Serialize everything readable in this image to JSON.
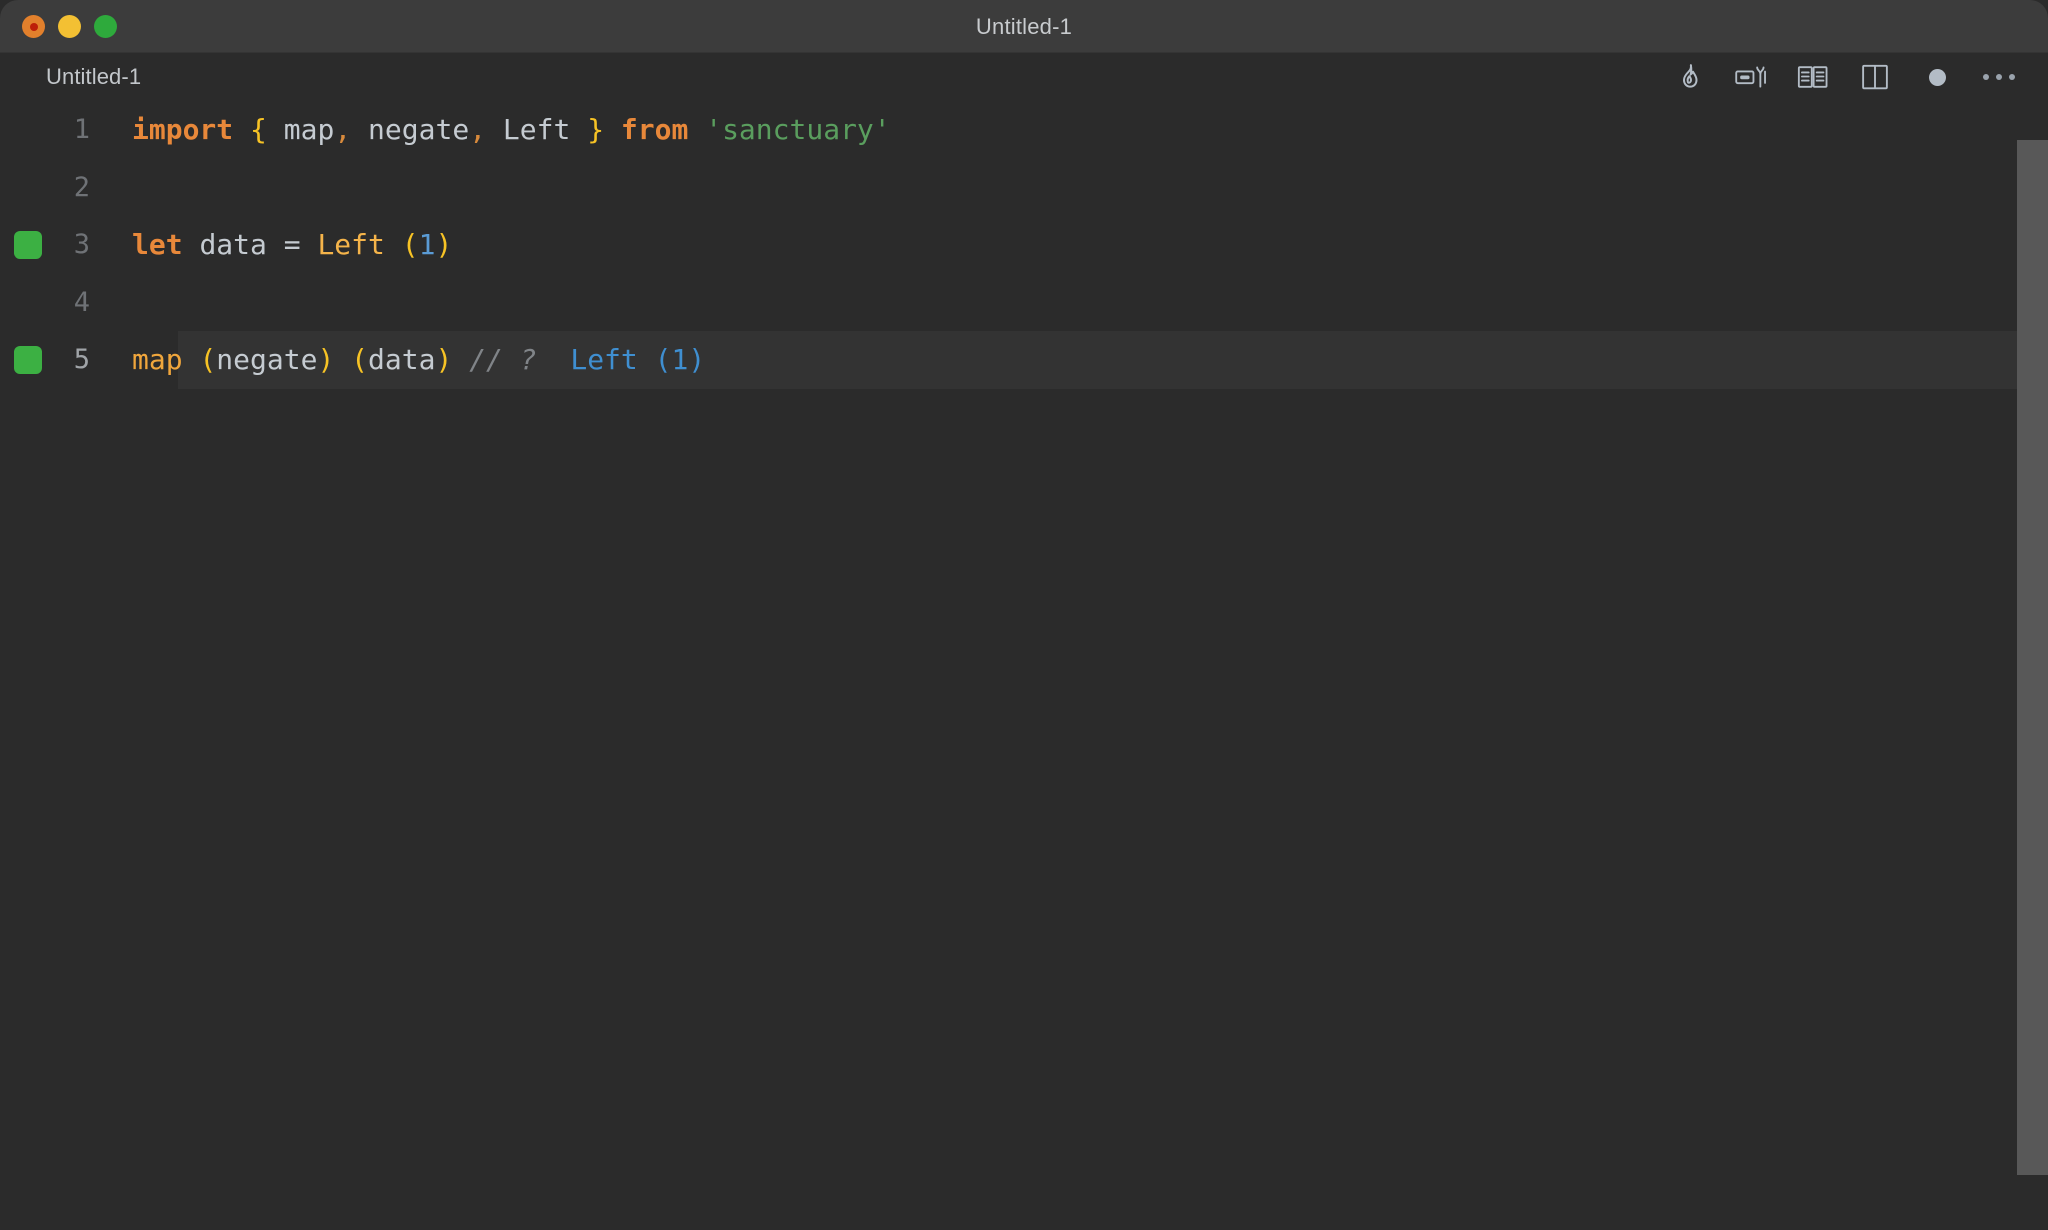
{
  "window": {
    "title": "Untitled-1",
    "traffic_lights": [
      {
        "name": "close",
        "color": "#e2802c"
      },
      {
        "name": "minimize",
        "color": "#f3c033"
      },
      {
        "name": "maximize",
        "color": "#2eaa3c"
      }
    ]
  },
  "tabs": [
    {
      "label": "Untitled-1",
      "active": true,
      "dirty": true
    }
  ],
  "editor_actions": [
    {
      "name": "quokka-flame-icon",
      "title": "Start on Current File"
    },
    {
      "name": "run-code-icon",
      "title": "Run Code"
    },
    {
      "name": "open-preview-icon",
      "title": "Open Preview to the Side"
    },
    {
      "name": "split-editor-icon",
      "title": "Split Editor Right"
    },
    {
      "name": "unsaved-dot-icon",
      "title": "Unsaved changes"
    },
    {
      "name": "more-actions-icon",
      "title": "More Actions..."
    }
  ],
  "code": {
    "language": "javascript",
    "active_line": 5,
    "lines": [
      {
        "number": "1",
        "gutter": null,
        "active": false,
        "tokens": [
          {
            "t": "import",
            "c": "kw"
          },
          {
            "t": " ",
            "c": "ident"
          },
          {
            "t": "{",
            "c": "brace"
          },
          {
            "t": " ",
            "c": "ident"
          },
          {
            "t": "map",
            "c": "ident"
          },
          {
            "t": ",",
            "c": "punct"
          },
          {
            "t": " ",
            "c": "ident"
          },
          {
            "t": "negate",
            "c": "ident"
          },
          {
            "t": ",",
            "c": "punct"
          },
          {
            "t": " ",
            "c": "ident"
          },
          {
            "t": "Left",
            "c": "ident"
          },
          {
            "t": " ",
            "c": "ident"
          },
          {
            "t": "}",
            "c": "brace"
          },
          {
            "t": " ",
            "c": "ident"
          },
          {
            "t": "from",
            "c": "kw"
          },
          {
            "t": " ",
            "c": "ident"
          },
          {
            "t": "'sanctuary'",
            "c": "str"
          }
        ]
      },
      {
        "number": "2",
        "gutter": null,
        "active": false,
        "tokens": []
      },
      {
        "number": "3",
        "gutter": "green",
        "active": false,
        "tokens": [
          {
            "t": "let",
            "c": "kw"
          },
          {
            "t": " ",
            "c": "ident"
          },
          {
            "t": "data",
            "c": "ident"
          },
          {
            "t": " ",
            "c": "ident"
          },
          {
            "t": "=",
            "c": "ident"
          },
          {
            "t": " ",
            "c": "ident"
          },
          {
            "t": "Left",
            "c": "fname"
          },
          {
            "t": " ",
            "c": "ident"
          },
          {
            "t": "(",
            "c": "paren"
          },
          {
            "t": "1",
            "c": "num"
          },
          {
            "t": ")",
            "c": "paren"
          }
        ]
      },
      {
        "number": "4",
        "gutter": null,
        "active": false,
        "tokens": []
      },
      {
        "number": "5",
        "gutter": "green",
        "active": true,
        "tokens": [
          {
            "t": "map",
            "c": "fcall"
          },
          {
            "t": " ",
            "c": "ident"
          },
          {
            "t": "(",
            "c": "paren"
          },
          {
            "t": "negate",
            "c": "ident"
          },
          {
            "t": ")",
            "c": "paren"
          },
          {
            "t": " ",
            "c": "ident"
          },
          {
            "t": "(",
            "c": "paren"
          },
          {
            "t": "data",
            "c": "ident"
          },
          {
            "t": ")",
            "c": "paren"
          },
          {
            "t": " ",
            "c": "ident"
          },
          {
            "t": "// ?",
            "c": "comment"
          },
          {
            "t": "  ",
            "c": "ident"
          },
          {
            "t": "Left (1)",
            "c": "result"
          }
        ]
      }
    ]
  },
  "colors": {
    "window_chrome": "#3c3c3c",
    "editor_bg": "#2b2b2b",
    "active_line_bg": "#333333",
    "gutter_marker": "#3cb043",
    "scrollbar": "#585858",
    "keyword": "#e8883a",
    "brace": "#f7c325",
    "string": "#5a9e5e",
    "number": "#5a9bd5",
    "comment": "#808488",
    "inline_result": "#3f8fd1"
  }
}
